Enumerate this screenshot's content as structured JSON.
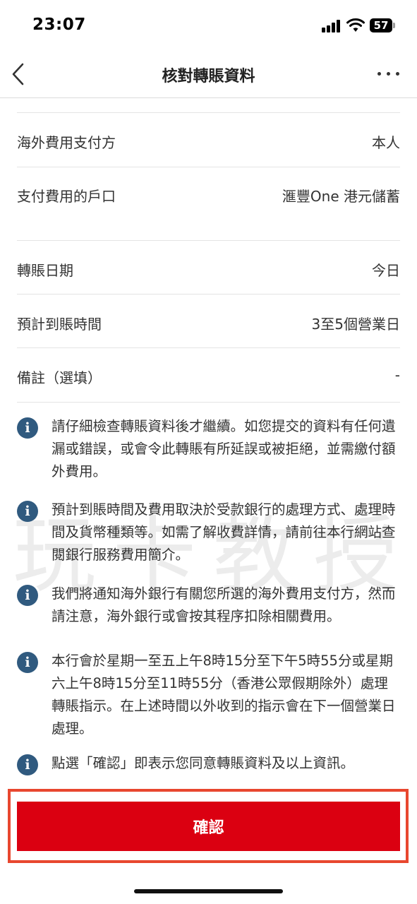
{
  "status_bar": {
    "time": "23:07",
    "battery": "57"
  },
  "nav": {
    "title": "核對轉賬資料"
  },
  "rows": [
    {
      "label": "海外費用支付方",
      "value": "本人"
    },
    {
      "label": "支付費用的戶口",
      "value": "滙豐One 港元儲蓄"
    },
    {
      "label": "轉賬日期",
      "value": "今日"
    },
    {
      "label": "預計到賬時間",
      "value": "3至5個營業日"
    },
    {
      "label": "備註（選填）",
      "value": "-"
    }
  ],
  "notes": [
    "請仔細檢查轉賬資料後才繼續。如您提交的資料有任何遺漏或錯誤，或會令此轉賬有所延誤或被拒絕，並需繳付額外費用。",
    "預計到賬時間及費用取決於受款銀行的處理方式、處理時間及貨幣種類等。如需了解收費詳情，請前往本行網站查閱銀行服務費用簡介。",
    "我們將通知海外銀行有關您所選的海外費用支付方，然而請注意，海外銀行或會按其程序扣除相關費用。",
    "本行會於星期一至五上午8時15分至下午5時55分或星期六上午8時15分至11時55分（香港公眾假期除外）處理轉賬指示。在上述時間以外收到的指示會在下一個營業日處理。",
    "點選「確認」即表示您同意轉賬資料及以上資訊。"
  ],
  "watermark": "玩卡教授",
  "confirm_button": {
    "label": "確認"
  },
  "colors": {
    "primary_red": "#db0011",
    "info_icon": "#305a7f",
    "highlight": "#e8472f"
  }
}
